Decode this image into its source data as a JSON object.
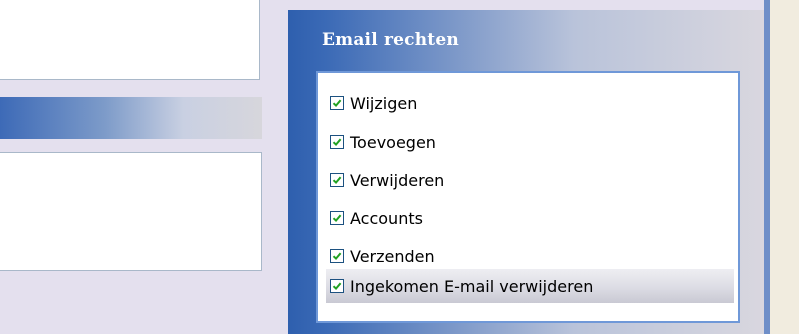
{
  "email_rights": {
    "title": "Email rechten",
    "items": [
      {
        "label": "Wijzigen",
        "checked": true
      },
      {
        "label": "Toevoegen",
        "checked": true
      },
      {
        "label": "Verwijderen",
        "checked": true
      },
      {
        "label": "Accounts",
        "checked": true
      },
      {
        "label": "Verzenden",
        "checked": true
      },
      {
        "label": "Ingekomen E-mail verwijderen",
        "checked": true,
        "selected": true
      }
    ]
  },
  "colors": {
    "header_gradient_start": "#2e5fae",
    "checkmark": "#21a121",
    "checkbox_border": "#1c5180",
    "list_border": "#6f98d8"
  }
}
